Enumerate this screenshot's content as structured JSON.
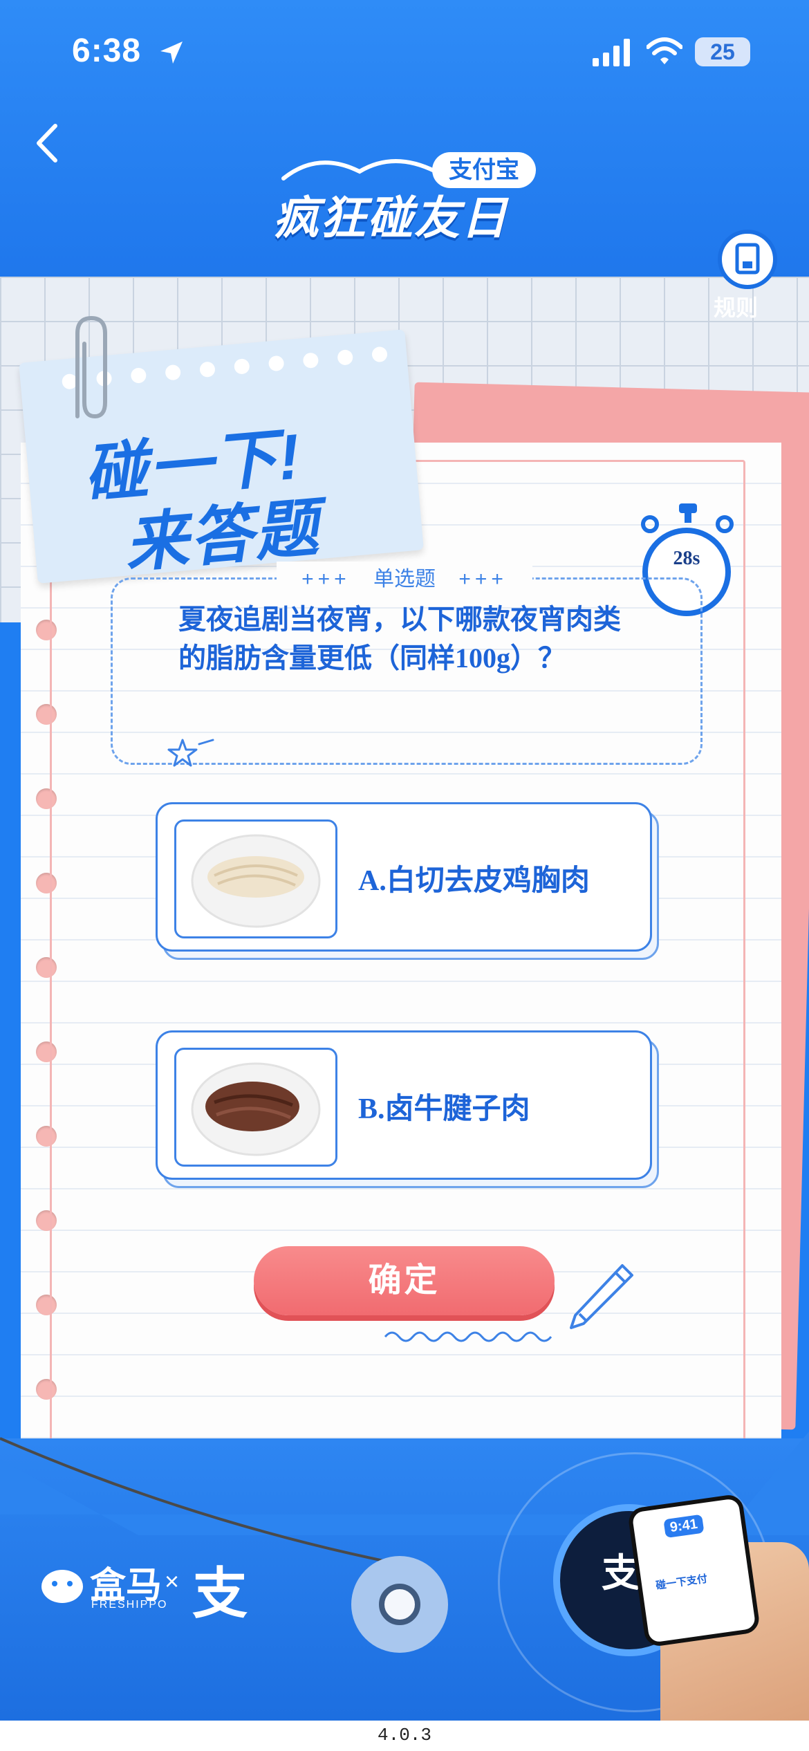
{
  "status_bar": {
    "time": "6:38",
    "battery": "25",
    "icons": [
      "location-arrow-icon",
      "signal-icon",
      "wifi-icon",
      "battery-icon"
    ]
  },
  "header": {
    "back_icon": "chevron-left-icon",
    "brand_tag": "支付宝",
    "event_title": "疯狂碰友日",
    "rules_label": "规则"
  },
  "note_card": {
    "line1": "碰一下!",
    "line2": "来答题"
  },
  "timer": {
    "remaining": "28s"
  },
  "question": {
    "type_label": "单选题",
    "type_decoration": "+++",
    "text": "夏夜追剧当夜宵，以下哪款夜宵肉类的脂肪含量更低（同样100g）？"
  },
  "options": [
    {
      "label": "A.白切去皮鸡胸肉",
      "image": "chicken-breast-plate"
    },
    {
      "label": "B.卤牛腱子肉",
      "image": "braised-beef-plate"
    }
  ],
  "confirm_button": "确定",
  "footer": {
    "partner_name": "盒马",
    "partner_en": "FRESHIPPO",
    "times_sign": "×",
    "alipay_glyph": "支",
    "nfc_glyph": "支",
    "phone_time": "9:41",
    "phone_cta": "碰一下支付"
  },
  "version": "4.0.3",
  "colors": {
    "primary_blue": "#1a6fe3",
    "confirm_pink": "#f16b70",
    "paper_pink": "#f4a6a7"
  }
}
